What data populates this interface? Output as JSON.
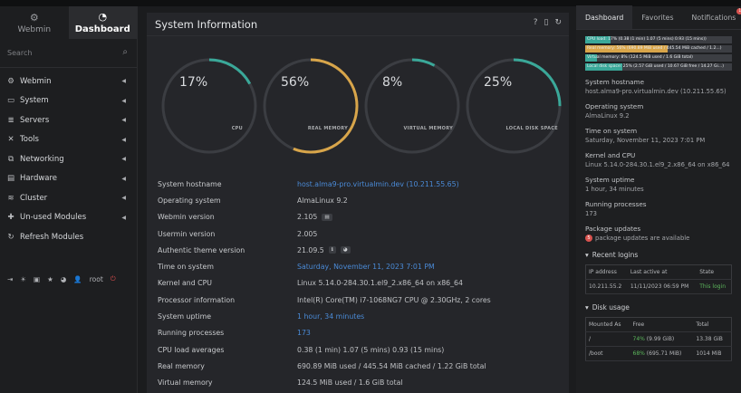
{
  "sidebar": {
    "tabs": [
      {
        "label": "Webmin",
        "icon": "webmin-icon"
      },
      {
        "label": "Dashboard",
        "icon": "dashboard-icon"
      }
    ],
    "search_placeholder": "Search",
    "items": [
      {
        "label": "Webmin",
        "icon": "gear-icon"
      },
      {
        "label": "System",
        "icon": "monitor-icon"
      },
      {
        "label": "Servers",
        "icon": "server-icon"
      },
      {
        "label": "Tools",
        "icon": "wrench-icon"
      },
      {
        "label": "Networking",
        "icon": "network-icon"
      },
      {
        "label": "Hardware",
        "icon": "hdd-icon"
      },
      {
        "label": "Cluster",
        "icon": "layers-icon"
      },
      {
        "label": "Un-used Modules",
        "icon": "puzzle-icon"
      },
      {
        "label": "Refresh Modules",
        "icon": "refresh-icon"
      }
    ],
    "bottom_user": "root"
  },
  "main": {
    "title": "System Information",
    "gauges": [
      {
        "pct": "17%",
        "label": "CPU",
        "value": 0.17
      },
      {
        "pct": "56%",
        "label": "REAL MEMORY",
        "value": 0.56
      },
      {
        "pct": "8%",
        "label": "VIRTUAL MEMORY",
        "value": 0.08
      },
      {
        "pct": "25%",
        "label": "LOCAL DISK SPACE",
        "value": 0.25
      }
    ],
    "rows": [
      {
        "k": "System hostname",
        "v": "host.alma9-pro.virtualmin.dev (10.211.55.65)",
        "link": true
      },
      {
        "k": "Operating system",
        "v": "AlmaLinux 9.2",
        "link": false
      },
      {
        "k": "Webmin version",
        "v": "2.105",
        "link": false
      },
      {
        "k": "Usermin version",
        "v": "2.005",
        "link": false
      },
      {
        "k": "Authentic theme version",
        "v": "21.09.5",
        "link": false
      },
      {
        "k": "Time on system",
        "v": "Saturday, November 11, 2023 7:01 PM",
        "link": true
      },
      {
        "k": "Kernel and CPU",
        "v": "Linux 5.14.0-284.30.1.el9_2.x86_64 on x86_64",
        "link": false
      },
      {
        "k": "Processor information",
        "v": "Intel(R) Core(TM) i7-1068NG7 CPU @ 2.30GHz, 2 cores",
        "link": false
      },
      {
        "k": "System uptime",
        "v": "1 hour, 34 minutes",
        "link": true
      },
      {
        "k": "Running processes",
        "v": "173",
        "link": true
      },
      {
        "k": "CPU load averages",
        "v": "0.38 (1 min) 1.07 (5 mins) 0.93 (15 mins)",
        "link": false
      },
      {
        "k": "Real memory",
        "v": "690.89 MiB used / 445.54 MiB cached / 1.22 GiB total",
        "link": false
      },
      {
        "k": "Virtual memory",
        "v": "124.5 MiB used / 1.6 GiB total",
        "link": false
      }
    ]
  },
  "right": {
    "tabs": [
      "Dashboard",
      "Favorites",
      "Notifications"
    ],
    "notif_count": "1",
    "bars": [
      {
        "text": "CPU load: 17% (0.38 (1 min) 1.07 (5 mins) 0.93 (15 mins))",
        "fill": 0.17,
        "color": "#3aa899"
      },
      {
        "text": "Real memory: 56% (690.89 MiB used / 445.54 MiB cached / 1.2…)",
        "fill": 0.56,
        "color": "#d8a54a"
      },
      {
        "text": "Virtual memory: 8% (124.5 MiB used / 1.6 GiB total)",
        "fill": 0.08,
        "color": "#3aa899"
      },
      {
        "text": "Local disk space: 25% (2.57 GiB used / 10.67 GiB free / 14.27 Gi…)",
        "fill": 0.25,
        "color": "#3aa899"
      }
    ],
    "info": [
      {
        "k": "System hostname",
        "v": "host.alma9-pro.virtualmin.dev (10.211.55.65)"
      },
      {
        "k": "Operating system",
        "v": "AlmaLinux 9.2"
      },
      {
        "k": "Time on system",
        "v": "Saturday, November 11, 2023 7:01 PM"
      },
      {
        "k": "Kernel and CPU",
        "v": "Linux 5.14.0-284.30.1.el9_2.x86_64 on x86_64"
      },
      {
        "k": "System uptime",
        "v": "1 hour, 34 minutes"
      },
      {
        "k": "Running processes",
        "v": "173"
      }
    ],
    "pkg_label": "Package updates",
    "pkg_count": "5",
    "pkg_text": "package updates are available",
    "recent_logins": {
      "title": "Recent logins",
      "headers": [
        "IP address",
        "Last active at",
        "State"
      ],
      "rows": [
        [
          "10.211.55.2",
          "11/11/2023 06:59 PM",
          "This login"
        ]
      ]
    },
    "disk_usage": {
      "title": "Disk usage",
      "headers": [
        "Mounted As",
        "Free",
        "Total"
      ],
      "rows": [
        [
          "/",
          "74%",
          "(9.99 GiB)",
          "13.38 GiB"
        ],
        [
          "/boot",
          "68%",
          "(695.71 MiB)",
          "1014 MiB"
        ]
      ]
    }
  }
}
